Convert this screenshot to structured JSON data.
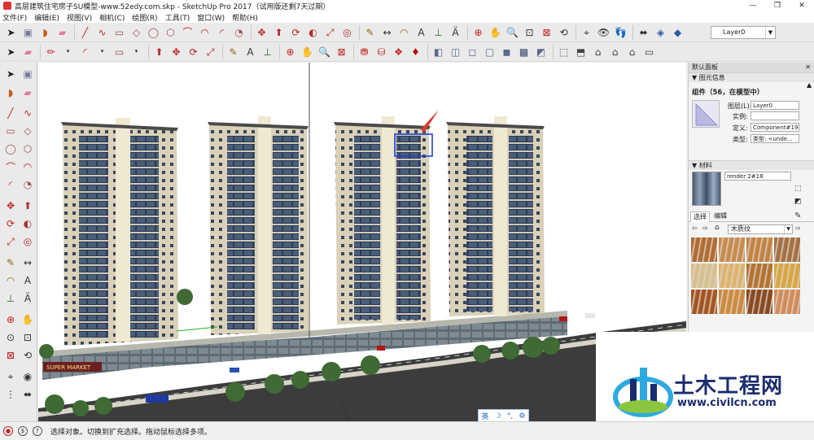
{
  "window": {
    "title": "高层建筑住宅房子SU模型-www.52edy.com.skp - SketchUp Pro 2017（试用版还剩7天过期）",
    "controls": [
      "—",
      "❐",
      "✕"
    ]
  },
  "menu": [
    "文件(F)",
    "编辑(E)",
    "视图(V)",
    "相机(C)",
    "绘图(R)",
    "工具(T)",
    "窗口(W)",
    "帮助(H)"
  ],
  "toolbar": {
    "layer_current": "Layer0"
  },
  "viewport": {
    "sign_text": "SUPER MARKET"
  },
  "panel": {
    "title": "默认面板",
    "entity_info": {
      "section_label": "图元信息",
      "entity_type": "组件（56，在模型中）",
      "layer_label": "图层(L):",
      "layer_value": "Layer0",
      "instance_label": "实例:",
      "instance_value": "",
      "definition_label": "定义:",
      "definition_value": "Component#19",
      "type_label": "类型:",
      "type_value": "类型: <unde..."
    },
    "materials": {
      "section_label": "材料",
      "material_name": "render 2#18",
      "tab_select": "选择",
      "tab_edit": "编辑",
      "library": "木质纹",
      "swatch_colors": [
        "#b36b2f",
        "#c98b4a",
        "#c6823f",
        "#a7703f",
        "#d9c08b",
        "#e0b36a",
        "#b5732f",
        "#d9a640",
        "#a8541f",
        "#cf8a3c",
        "#8a4a20",
        "#d48b57"
      ]
    }
  },
  "status": {
    "hint": "选择对象。切换到扩充选择。拖动鼠标选择多项。"
  },
  "ime": {
    "lang": "英",
    "moon": "☽",
    "punct": "°,",
    "gear": "⚙"
  },
  "watermark": {
    "brand": "土木工程网",
    "url": "www.civilcn.com"
  }
}
